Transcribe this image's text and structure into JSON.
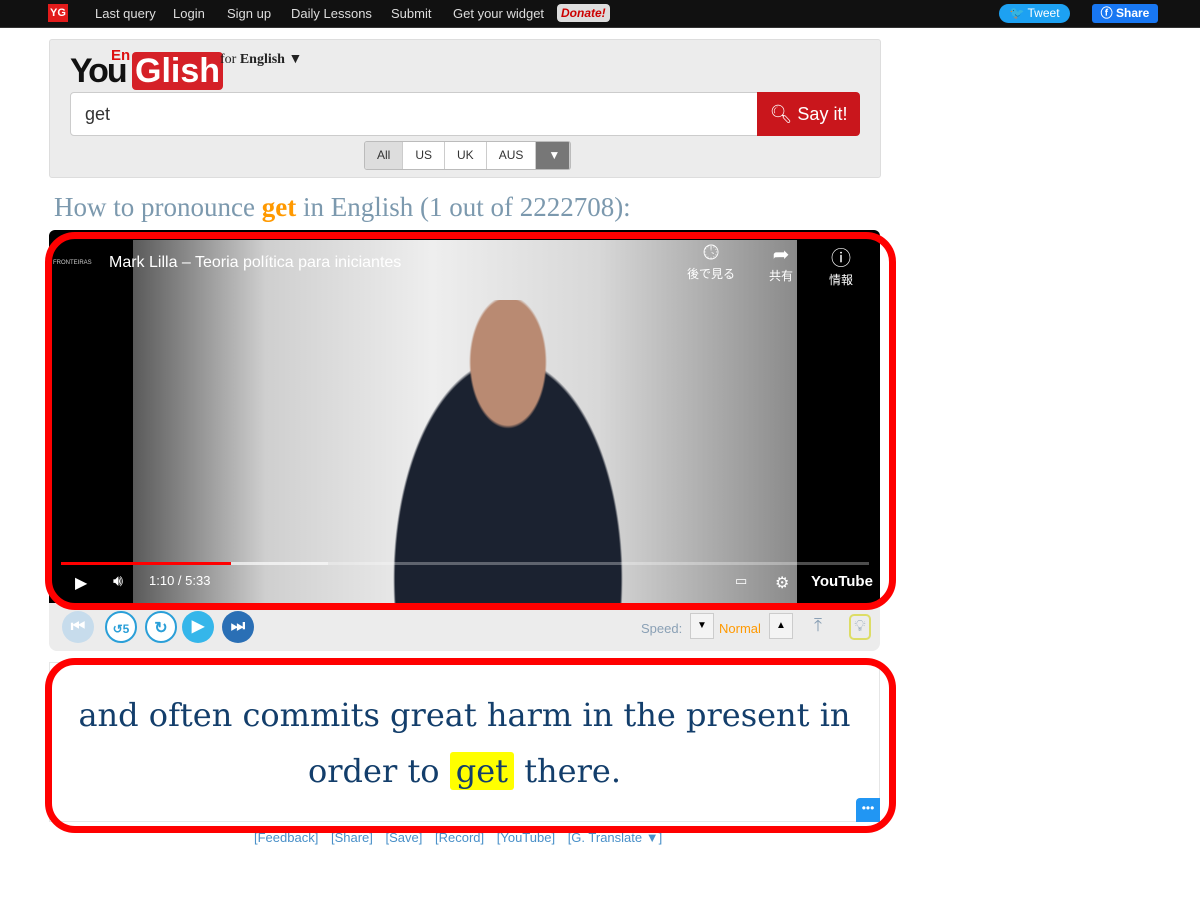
{
  "topbar": {
    "logo": "YG",
    "nav": [
      "Last query",
      "Login",
      "Sign up",
      "Daily Lessons",
      "Submit",
      "Get your widget"
    ],
    "donate": "Donate!",
    "tweet": "Tweet",
    "share": "Share"
  },
  "logo": {
    "you": "You",
    "en": "En",
    "glish": "Glish",
    "for": "for",
    "language": "English ▼"
  },
  "search": {
    "value": "get",
    "button": "Say it!"
  },
  "accents": [
    "All",
    "US",
    "UK",
    "AUS"
  ],
  "heading": {
    "pre": "How to pronounce",
    "keyword": "get",
    "post": "in English (1 out of 2222708):"
  },
  "video": {
    "title": "Mark Lilla – Teoria política para iniciantes",
    "watch_later": "後で見る",
    "share": "共有",
    "info": "情報",
    "time": "1:10 / 5:33",
    "progress_percent": 21,
    "youtube": "YouTube",
    "channel": "FRONTEIRAS"
  },
  "controls": {
    "speed_label": "Speed:",
    "speed_value": "Normal"
  },
  "caption": {
    "before": "and often commits great harm in the present in order to",
    "keyword": "get",
    "after": "there."
  },
  "links": [
    "[Feedback]",
    "[Share]",
    "[Save]",
    "[Record]",
    "[YouTube]",
    "[G. Translate ▼]"
  ],
  "colors": {
    "accent": "#f90",
    "brand_red": "#d52027",
    "caption": "#133e6b",
    "highlight": "#ffff00"
  }
}
